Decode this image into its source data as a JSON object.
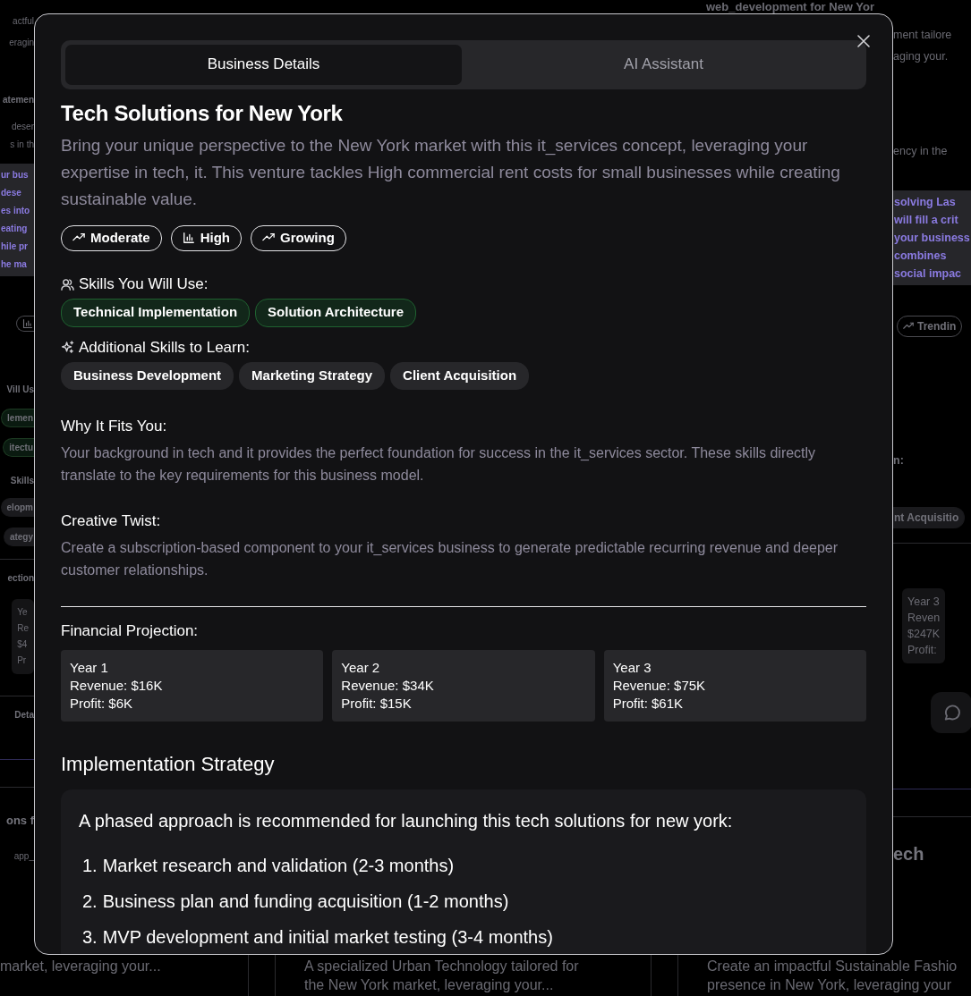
{
  "background": {
    "top_strip": [
      {
        "kind": "heading",
        "text": "web_development for New Yor"
      }
    ],
    "left_strip": [
      {
        "kind": "text",
        "text": "actful"
      },
      {
        "kind": "text",
        "text": "eragin"
      },
      {
        "kind": "heading",
        "text": "atemen"
      },
      {
        "kind": "text",
        "text": "deser"
      },
      {
        "kind": "text",
        "text": "s in th"
      },
      {
        "kind": "highlight",
        "lines": [
          "ur bus",
          "dese",
          "es into",
          "eating",
          "hile pr",
          "he ma"
        ]
      },
      {
        "kind": "icon_pill"
      },
      {
        "kind": "heading",
        "text": "Vill Us"
      },
      {
        "kind": "green_pill",
        "text": "lemen"
      },
      {
        "kind": "green_pill",
        "text": "itectu"
      },
      {
        "kind": "heading",
        "text": "Skills"
      },
      {
        "kind": "pill",
        "text": "elopm"
      },
      {
        "kind": "pill",
        "text": "ategy"
      },
      {
        "kind": "divider"
      },
      {
        "kind": "heading",
        "text": "ection"
      },
      {
        "kind": "card",
        "lines": [
          "Ye",
          "Re",
          "$4",
          "Pr"
        ]
      },
      {
        "kind": "divider"
      },
      {
        "kind": "heading",
        "text": "Deta"
      },
      {
        "kind": "accent_line"
      },
      {
        "kind": "divider"
      },
      {
        "kind": "title",
        "text": "ons f"
      },
      {
        "kind": "text",
        "text": "app_"
      }
    ],
    "right_strip": [
      {
        "kind": "text",
        "text": "ment tailore"
      },
      {
        "kind": "text",
        "text": "aging your."
      },
      {
        "kind": "text",
        "text": "ency in the"
      },
      {
        "kind": "highlight",
        "lines": [
          "solving Las",
          "will fill a crit",
          "your business",
          "combines",
          "social impac"
        ]
      },
      {
        "kind": "icon_pill",
        "text": "Trendin"
      },
      {
        "kind": "heading",
        "text": "n:"
      },
      {
        "kind": "pill",
        "text": "nt Acquisitio"
      },
      {
        "kind": "divider"
      },
      {
        "kind": "card",
        "lines": [
          "Year 3",
          "Reven",
          "$247K",
          "Profit:"
        ]
      },
      {
        "kind": "icon_button"
      },
      {
        "kind": "accent_line"
      },
      {
        "kind": "divider"
      },
      {
        "kind": "title",
        "text": "ech"
      }
    ],
    "bottom_strip": [
      {
        "lines": [
          "market, leveraging your..."
        ]
      },
      {
        "lines": [
          "A specialized Urban Technology tailored for",
          "the New York market, leveraging your..."
        ]
      },
      {
        "lines": [
          "Create an impactful Sustainable Fashio",
          "presence in New York, leveraging your"
        ]
      }
    ]
  },
  "modal": {
    "tabs": [
      {
        "label": "Business Details",
        "selected": true
      },
      {
        "label": "AI Assistant",
        "selected": false
      }
    ],
    "title": "Tech Solutions for New York",
    "description": "Bring your unique perspective to the New York market with this it_services concept, leveraging your expertise in tech, it. This venture tackles High commercial rent costs for small businesses while creating sustainable value.",
    "badges": [
      {
        "label": "Moderate"
      },
      {
        "label": "High"
      },
      {
        "label": "Growing"
      }
    ],
    "skills_heading": "Skills You Will Use:",
    "skills": [
      "Technical Implementation",
      "Solution Architecture"
    ],
    "learn_heading": "Additional Skills to Learn:",
    "learn_skills": [
      "Business Development",
      "Marketing Strategy",
      "Client Acquisition"
    ],
    "sections": [
      {
        "heading": "Why It Fits You:",
        "text": "Your background in tech and it provides the perfect foundation for success in the it_services sector. These skills directly translate to the key requirements for this business model."
      },
      {
        "heading": "Creative Twist:",
        "text": "Create a subscription-based component to your it_services business to generate predictable recurring revenue and deeper customer relationships."
      }
    ],
    "financial_heading": "Financial Projection:",
    "years": [
      {
        "year": "Year 1",
        "revenue": "Revenue: $16K",
        "profit": "Profit: $6K"
      },
      {
        "year": "Year 2",
        "revenue": "Revenue: $34K",
        "profit": "Profit: $15K"
      },
      {
        "year": "Year 3",
        "revenue": "Revenue: $75K",
        "profit": "Profit: $61K"
      }
    ],
    "strategy_heading": "Implementation Strategy",
    "strategy_intro": "A phased approach is recommended for launching this tech solutions for new york:",
    "steps": [
      {
        "number": "1.",
        "text": "Market research and validation (2-3 months)"
      },
      {
        "number": "2.",
        "text": "Business plan and funding acquisition (1-2 months)"
      },
      {
        "number": "3.",
        "text": "MVP development and initial market testing (3-4 months)"
      }
    ]
  }
}
